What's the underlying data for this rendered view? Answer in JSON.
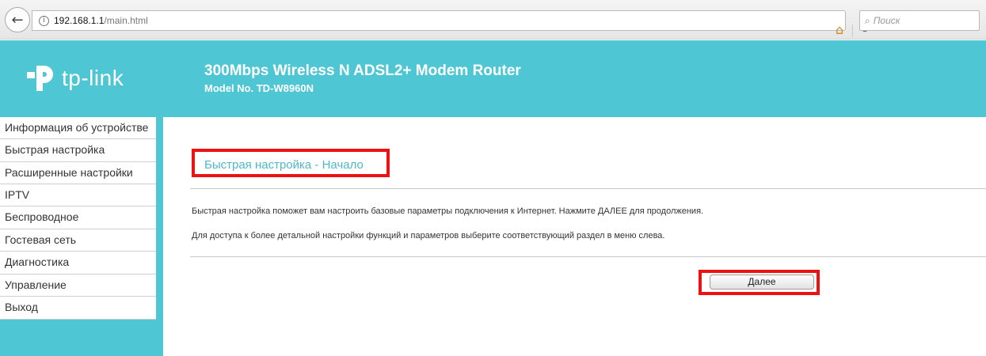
{
  "browser": {
    "url_host": "192.168.1.1",
    "url_path": "/main.html",
    "search_placeholder": "Поиск"
  },
  "header": {
    "logo_text": "tp-link",
    "product_name": "300Mbps Wireless N ADSL2+ Modem Router",
    "model_no": "Model No. TD-W8960N",
    "brand_color": "#4fc6d3"
  },
  "sidebar": {
    "items": [
      {
        "label": "Информация об устройстве"
      },
      {
        "label": "Быстрая настройка"
      },
      {
        "label": "Расширенные настройки"
      },
      {
        "label": "IPTV"
      },
      {
        "label": "Беспроводное"
      },
      {
        "label": "Гостевая сеть"
      },
      {
        "label": "Диагностика"
      },
      {
        "label": "Управление"
      },
      {
        "label": "Выход"
      }
    ]
  },
  "main": {
    "title": "Быстрая настройка - Начало",
    "description_1": "Быстрая настройка поможет вам настроить базовые параметры подключения к Интернет. Нажмите ДАЛЕЕ для продолжения.",
    "description_2": "Для доступа к более детальной настройки функций и параметров выберите соответствующий раздел в меню слева.",
    "next_button": "Далее",
    "highlight_color": "#ee1111"
  }
}
